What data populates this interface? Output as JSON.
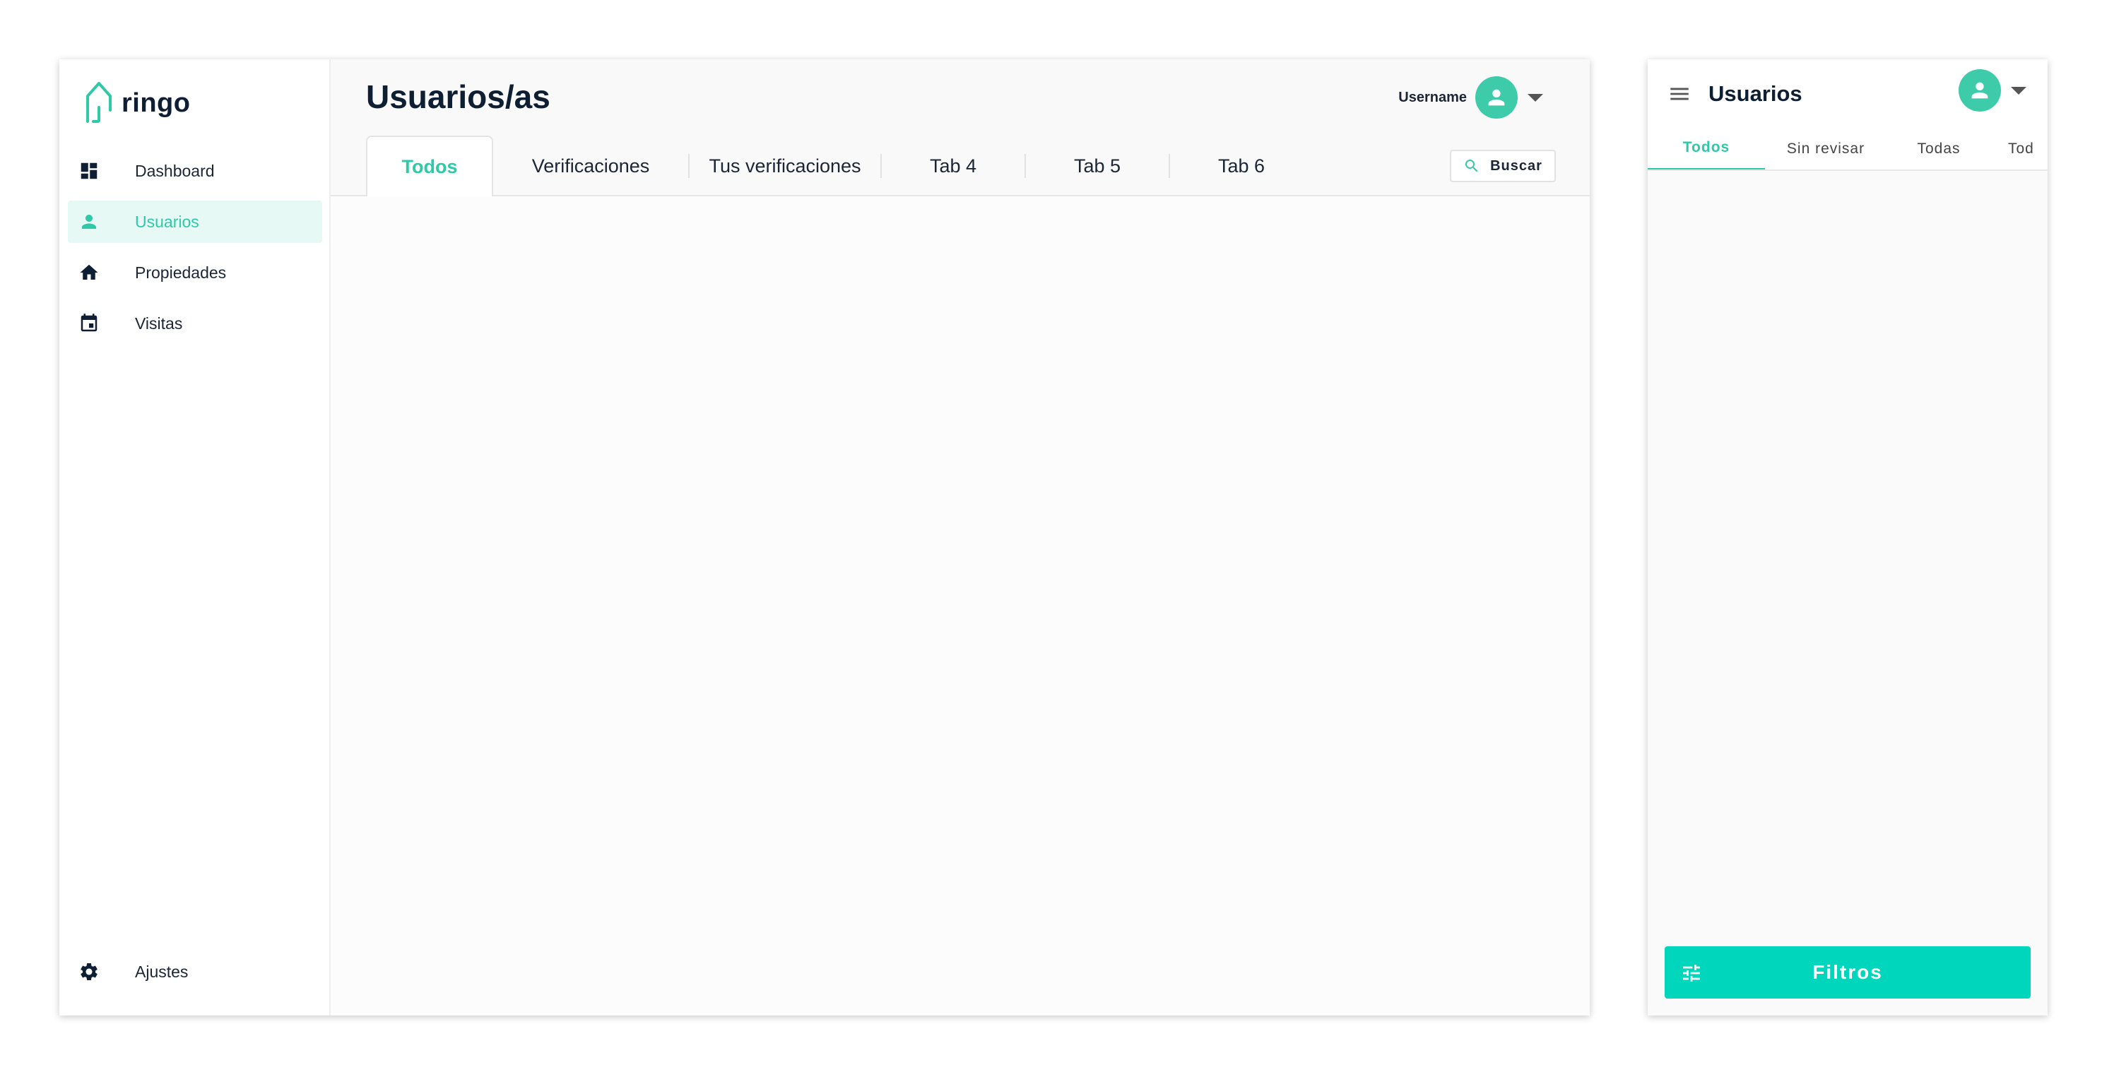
{
  "desktop": {
    "logo": {
      "text": "ringo",
      "icon": "ringo-logo-icon"
    },
    "sidebar": {
      "items": [
        {
          "label": "Dashboard",
          "icon": "dashboard-icon",
          "active": false
        },
        {
          "label": "Usuarios",
          "icon": "person-icon",
          "active": true
        },
        {
          "label": "Propiedades",
          "icon": "home-icon",
          "active": false
        },
        {
          "label": "Visitas",
          "icon": "calendar-icon",
          "active": false
        }
      ],
      "bottom": {
        "label": "Ajustes",
        "icon": "gear-icon"
      }
    },
    "header": {
      "title": "Usuarios/as",
      "username": "Username"
    },
    "tabs": [
      {
        "label": "Todos",
        "active": true
      },
      {
        "label": "Verificaciones",
        "active": false
      },
      {
        "label": "Tus verificaciones",
        "active": false
      },
      {
        "label": "Tab 4",
        "active": false
      },
      {
        "label": "Tab 5",
        "active": false
      },
      {
        "label": "Tab 6",
        "active": false
      }
    ],
    "search": {
      "label": "Buscar",
      "icon": "search-icon"
    }
  },
  "mobile": {
    "header": {
      "title": "Usuarios",
      "menu_icon": "hamburger-icon"
    },
    "tabs": [
      {
        "label": "Todos",
        "active": true
      },
      {
        "label": "Sin revisar",
        "active": false
      },
      {
        "label": "Todas",
        "active": false
      },
      {
        "label": "Tod",
        "active": false
      }
    ],
    "filters_button": {
      "label": "Filtros",
      "icon": "sliders-icon"
    }
  },
  "colors": {
    "accent": "#2ec9a7",
    "button": "#00d6bb",
    "active_bg": "#e6f9f4",
    "text_dark": "#0f1f33"
  }
}
